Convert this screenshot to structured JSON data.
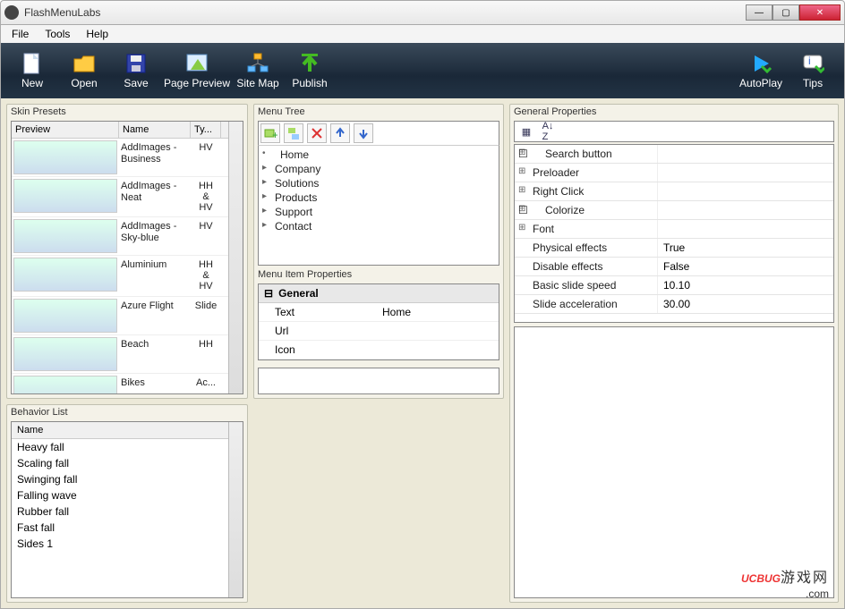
{
  "window": {
    "title": "FlashMenuLabs"
  },
  "menubar": [
    "File",
    "Tools",
    "Help"
  ],
  "toolbar": {
    "left": [
      {
        "id": "new",
        "label": "New"
      },
      {
        "id": "open",
        "label": "Open"
      },
      {
        "id": "save",
        "label": "Save"
      },
      {
        "id": "page-preview",
        "label": "Page Preview"
      },
      {
        "id": "sitemap",
        "label": "Site Map"
      },
      {
        "id": "publish",
        "label": "Publish"
      }
    ],
    "right": [
      {
        "id": "autoplay",
        "label": "AutoPlay"
      },
      {
        "id": "tips",
        "label": "Tips"
      }
    ]
  },
  "skin": {
    "title": "Skin Presets",
    "headers": [
      "Preview",
      "Name",
      "Ty..."
    ],
    "rows": [
      {
        "name": "AddImages - Business",
        "type": "HV"
      },
      {
        "name": "AddImages - Neat",
        "type": "HH & HV"
      },
      {
        "name": "AddImages - Sky-blue",
        "type": "HV"
      },
      {
        "name": "Aluminium",
        "type": "HH & HV"
      },
      {
        "name": "Azure Flight",
        "type": "Slide"
      },
      {
        "name": "Beach",
        "type": "HH"
      },
      {
        "name": "Bikes",
        "type": "Ac..."
      }
    ]
  },
  "menutree": {
    "title": "Menu Tree",
    "items": [
      "Home",
      "Company",
      "Solutions",
      "Products",
      "Support",
      "Contact"
    ]
  },
  "menuitemprops": {
    "title": "Menu Item Properties",
    "group": "General",
    "rows": [
      {
        "k": "Text",
        "v": "Home"
      },
      {
        "k": "Url",
        "v": ""
      },
      {
        "k": "Icon",
        "v": ""
      }
    ]
  },
  "generalprops": {
    "title": "General Properties",
    "rows": [
      {
        "k": "Search button",
        "v": "",
        "exp": true,
        "chk": true
      },
      {
        "k": "Preloader",
        "v": "",
        "exp": true
      },
      {
        "k": "Right Click",
        "v": "",
        "exp": true
      },
      {
        "k": "Colorize",
        "v": "",
        "exp": true,
        "chk": true
      },
      {
        "k": "Font",
        "v": "",
        "exp": true
      },
      {
        "k": "Physical effects",
        "v": "True"
      },
      {
        "k": "Disable effects",
        "v": "False"
      },
      {
        "k": "Basic slide speed",
        "v": "10.10"
      },
      {
        "k": "Slide acceleration",
        "v": "30.00"
      }
    ]
  },
  "behavior": {
    "title": "Behavior List",
    "header": "Name",
    "items": [
      "Heavy fall",
      "Scaling fall",
      "Swinging fall",
      "Falling wave",
      "Rubber fall",
      "Fast fall",
      "Sides 1"
    ]
  },
  "watermark": {
    "brand": "UCBUG",
    "cn": "游戏网",
    "dom": ".com"
  }
}
